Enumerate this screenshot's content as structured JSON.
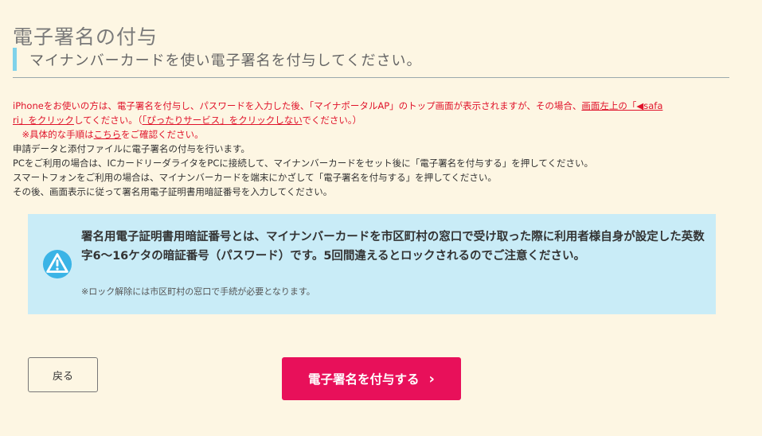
{
  "page": {
    "title": "電子署名の付与",
    "section_heading": "マイナンバーカードを使い電子署名を付与してください。"
  },
  "notes": {
    "iphone_a": "iPhoneをお使いの方は、電子署名を付与し、パスワードを入力した後、「マイナポータルAP」のトップ画面が表示されますが、その場合、",
    "iphone_link1": "画面左上の「◀safa",
    "iphone_link1b": "ri」をクリック",
    "iphone_b": "してください。（",
    "iphone_link2": "「ぴったりサービス」をクリックしない",
    "iphone_c": "でください。）",
    "detail_a": "　※具体的な手順は",
    "detail_link": "こちら",
    "detail_b": "をご確認ください。",
    "line1": "申請データと添付ファイルに電子署名の付与を行います。",
    "line2": "PCをご利用の場合は、ICカードリーダライタをPCに接続して、マイナンバーカードをセット後に「電子署名を付与する」を押してください。",
    "line3": "スマートフォンをご利用の場合は、マイナンバーカードを端末にかざして「電子署名を付与する」を押してください。",
    "line4": "その後、画面表示に従って署名用電子証明書用暗証番号を入力してください。"
  },
  "info": {
    "main": "署名用電子証明書用暗証番号とは、マイナンバーカードを市区町村の窓口で受け取った際に利用者様自身が設定した英数字6～16ケタの暗証番号（パスワード）です。5回間違えるとロックされるのでご注意ください。",
    "sub": "※ロック解除には市区町村の窓口で手続が必要となります。",
    "icon": "warning-icon"
  },
  "buttons": {
    "back": "戻る",
    "sign": "電子署名を付与する",
    "sign_chevron": "›"
  },
  "colors": {
    "background": "#fdf6e3",
    "accent_bar": "#7fd2ea",
    "info_box": "#c9ecf7",
    "warning_text": "#e0132a",
    "primary_button": "#e8105a"
  }
}
